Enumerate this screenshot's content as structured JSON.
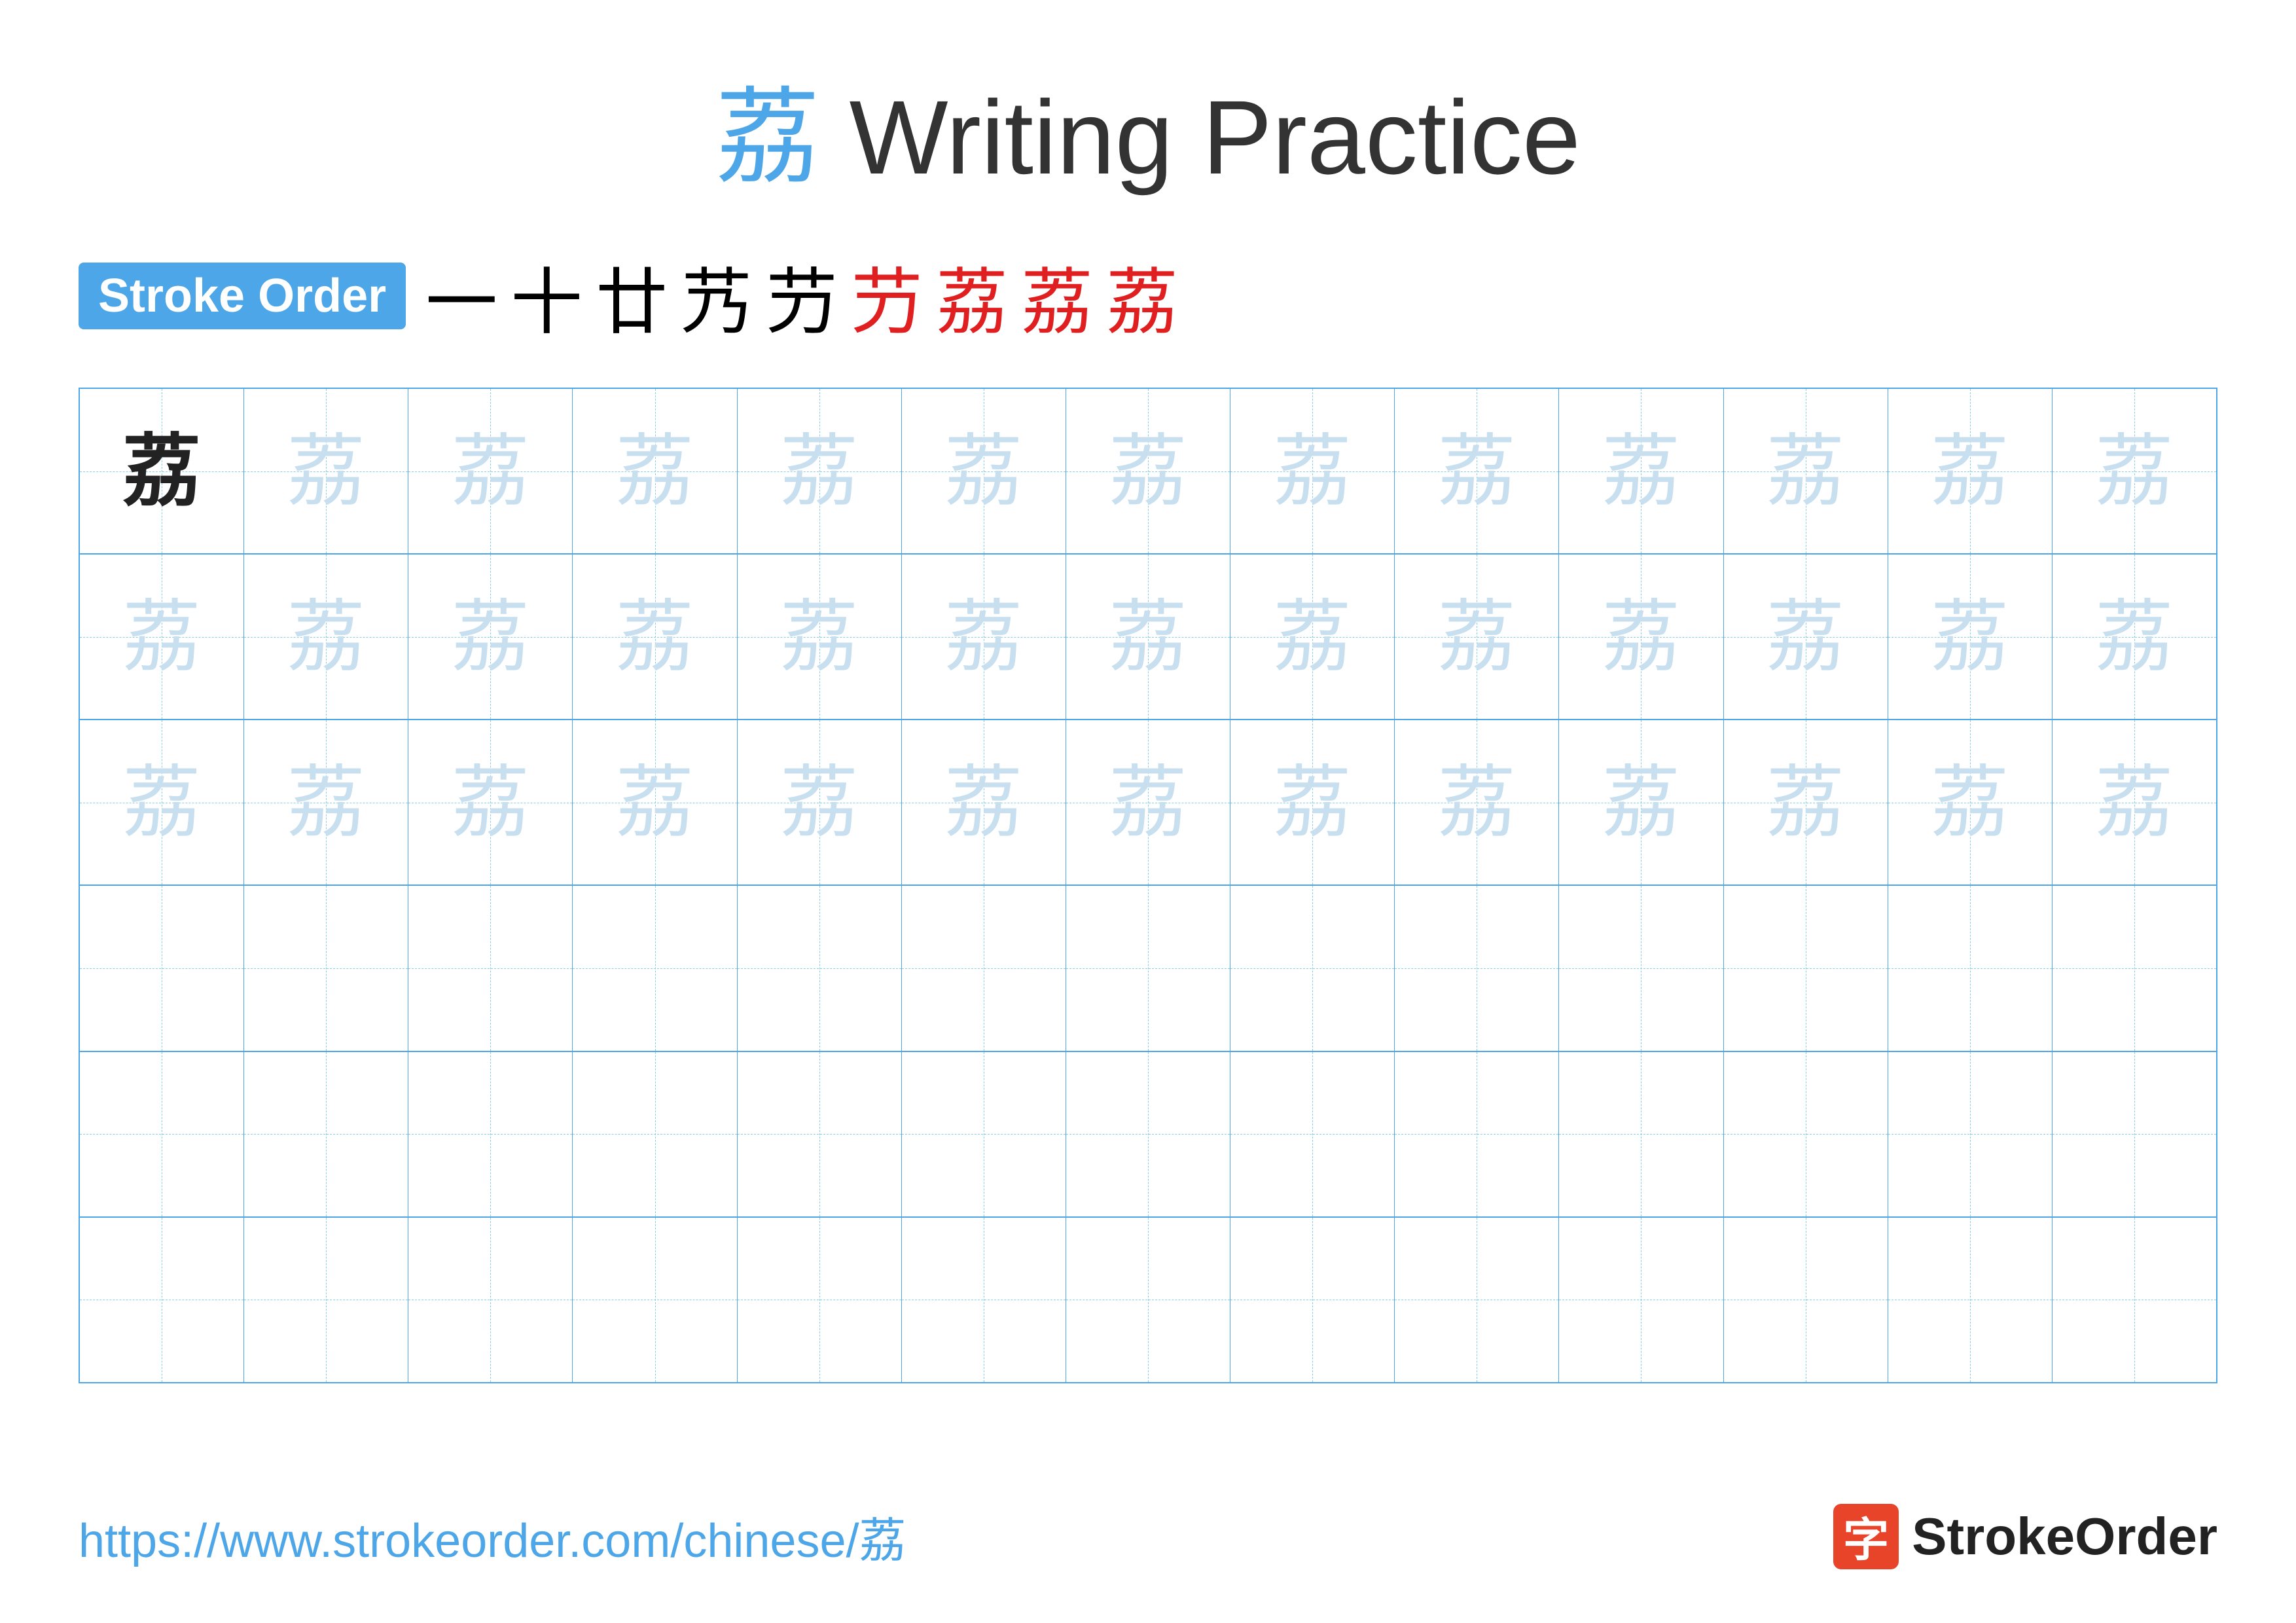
{
  "title": {
    "char": "荔",
    "text": " Writing Practice"
  },
  "stroke_order": {
    "badge_label": "Stroke Order",
    "strokes": [
      "一",
      "十",
      "廿",
      "艿",
      "芀",
      "芀",
      "荔",
      "荔",
      "荔"
    ]
  },
  "grid": {
    "cols": 13,
    "rows": [
      {
        "type": "chars",
        "cells": [
          "dark",
          "light",
          "light",
          "light",
          "light",
          "light",
          "light",
          "light",
          "light",
          "light",
          "light",
          "light",
          "light"
        ]
      },
      {
        "type": "chars",
        "cells": [
          "light",
          "light",
          "light",
          "light",
          "light",
          "light",
          "light",
          "light",
          "light",
          "light",
          "light",
          "light",
          "light"
        ]
      },
      {
        "type": "chars",
        "cells": [
          "light",
          "light",
          "light",
          "light",
          "light",
          "light",
          "light",
          "light",
          "light",
          "light",
          "light",
          "light",
          "light"
        ]
      },
      {
        "type": "empty",
        "cells": [
          "empty",
          "empty",
          "empty",
          "empty",
          "empty",
          "empty",
          "empty",
          "empty",
          "empty",
          "empty",
          "empty",
          "empty",
          "empty"
        ]
      },
      {
        "type": "empty",
        "cells": [
          "empty",
          "empty",
          "empty",
          "empty",
          "empty",
          "empty",
          "empty",
          "empty",
          "empty",
          "empty",
          "empty",
          "empty",
          "empty"
        ]
      },
      {
        "type": "empty",
        "cells": [
          "empty",
          "empty",
          "empty",
          "empty",
          "empty",
          "empty",
          "empty",
          "empty",
          "empty",
          "empty",
          "empty",
          "empty",
          "empty"
        ]
      }
    ],
    "char": "荔"
  },
  "footer": {
    "url": "https://www.strokeorder.com/chinese/荔",
    "logo_text": "StrokeOrder",
    "logo_icon": "字"
  },
  "colors": {
    "blue": "#4da6e8",
    "red": "#e02020",
    "light_char": "#c8dff0",
    "dark_char": "#222222"
  }
}
